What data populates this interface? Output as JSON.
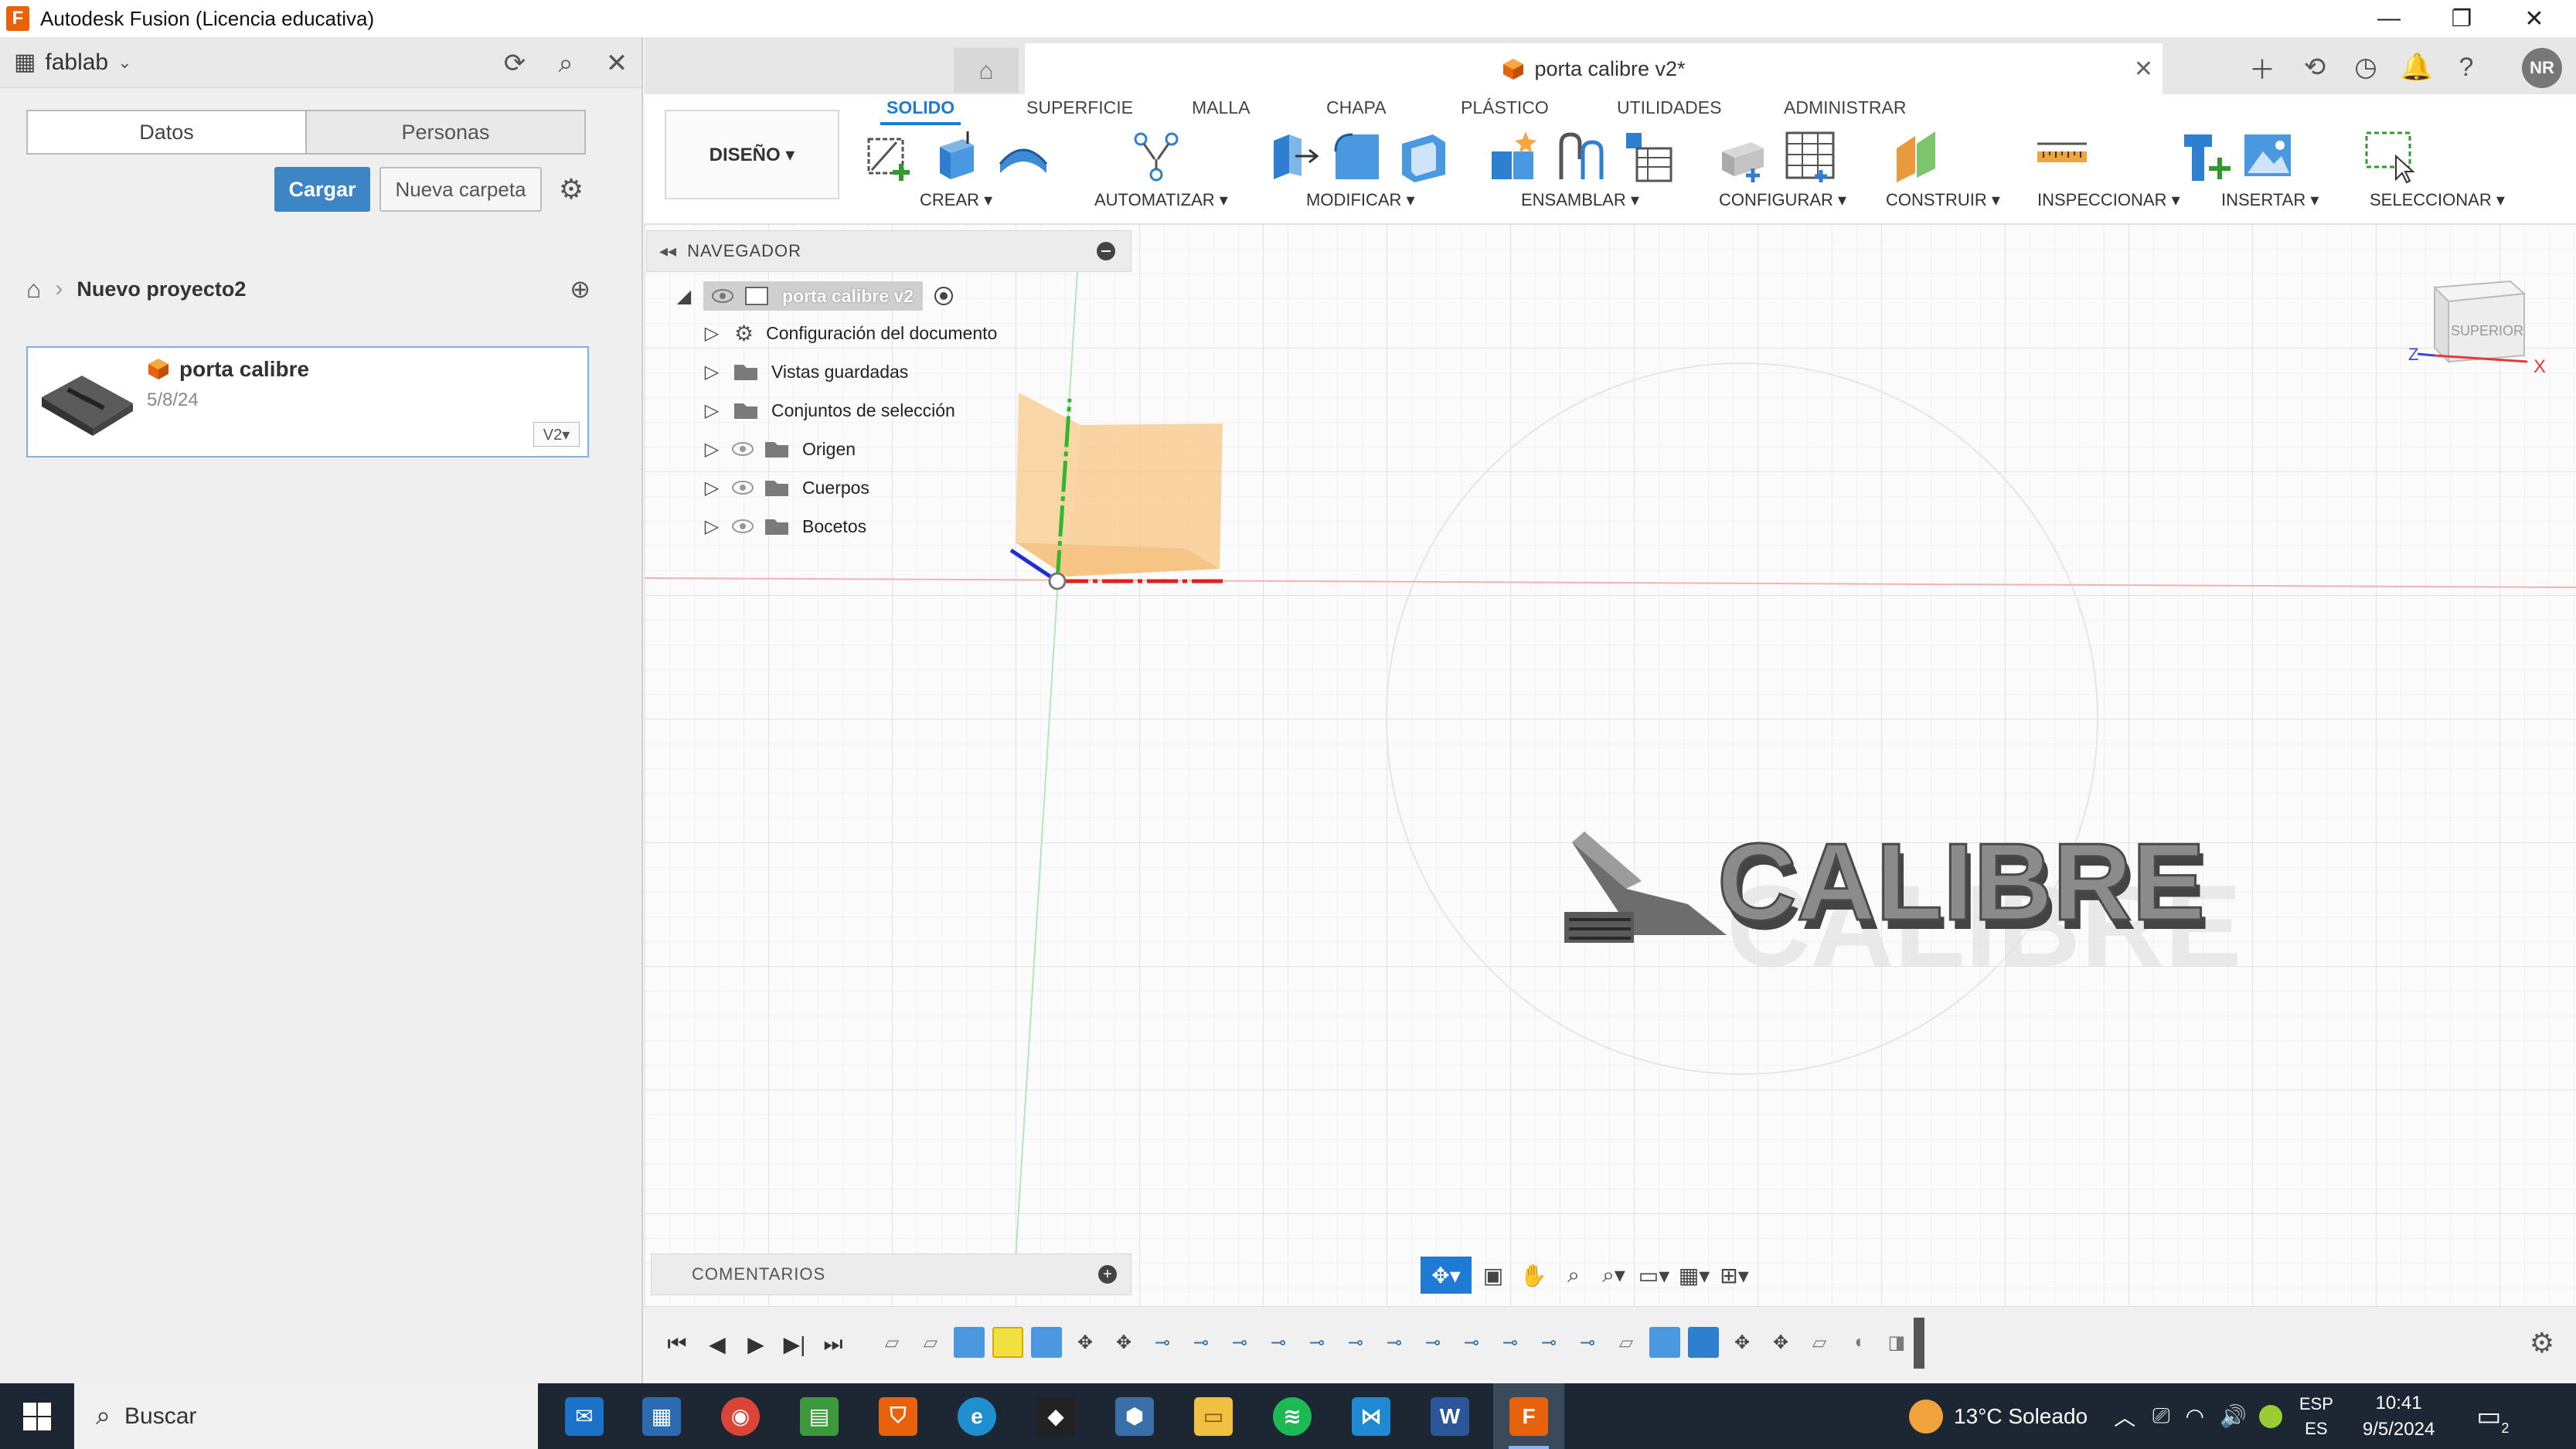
{
  "window": {
    "title": "Autodesk Fusion (Licencia educativa)",
    "controls": {
      "minimize": "—",
      "restore": "❐",
      "close": "✕"
    }
  },
  "data_panel": {
    "team": "fablab",
    "tabs": [
      "Datos",
      "Personas"
    ],
    "upload_label": "Cargar",
    "new_folder_label": "Nueva carpeta",
    "breadcrumb_project": "Nuevo proyecto2",
    "file": {
      "name": "porta calibre",
      "date": "5/8/24",
      "version": "V2▾"
    }
  },
  "doc_tab": {
    "name": "porta calibre v2*",
    "user_initials": "NR"
  },
  "toolbar": {
    "workspace": "DISEÑO ▾",
    "tabs": [
      "SOLIDO",
      "SUPERFICIE",
      "MALLA",
      "CHAPA",
      "PLÁSTICO",
      "UTILIDADES",
      "ADMINISTRAR"
    ],
    "groups": [
      "CREAR ▾",
      "AUTOMATIZAR ▾",
      "MODIFICAR ▾",
      "ENSAMBLAR ▾",
      "CONFIGURAR ▾",
      "CONSTRUIR ▾",
      "INSPECCIONAR ▾",
      "INSERTAR ▾",
      "SELECCIONAR ▾"
    ]
  },
  "navigator": {
    "title": "NAVEGADOR",
    "root": "porta calibre v2",
    "items": [
      "Configuración del documento",
      "Vistas guardadas",
      "Conjuntos de selección",
      "Origen",
      "Cuerpos",
      "Bocetos"
    ]
  },
  "comments": {
    "title": "COMENTARIOS"
  },
  "viewcube": {
    "face": "SUPERIOR",
    "axis_x": "X",
    "axis_z": "Z"
  },
  "model_text": "CALIBRE",
  "taskbar": {
    "search": "Buscar",
    "weather": "13°C  Soleado",
    "lang_top": "ESP",
    "lang_bottom": "ES",
    "time": "10:41",
    "date": "9/5/2024",
    "notif_count": "2"
  },
  "colors": {
    "accent": "#1f7ad4",
    "fusion_orange": "#e8620c",
    "primary_button": "#3d86c6"
  }
}
